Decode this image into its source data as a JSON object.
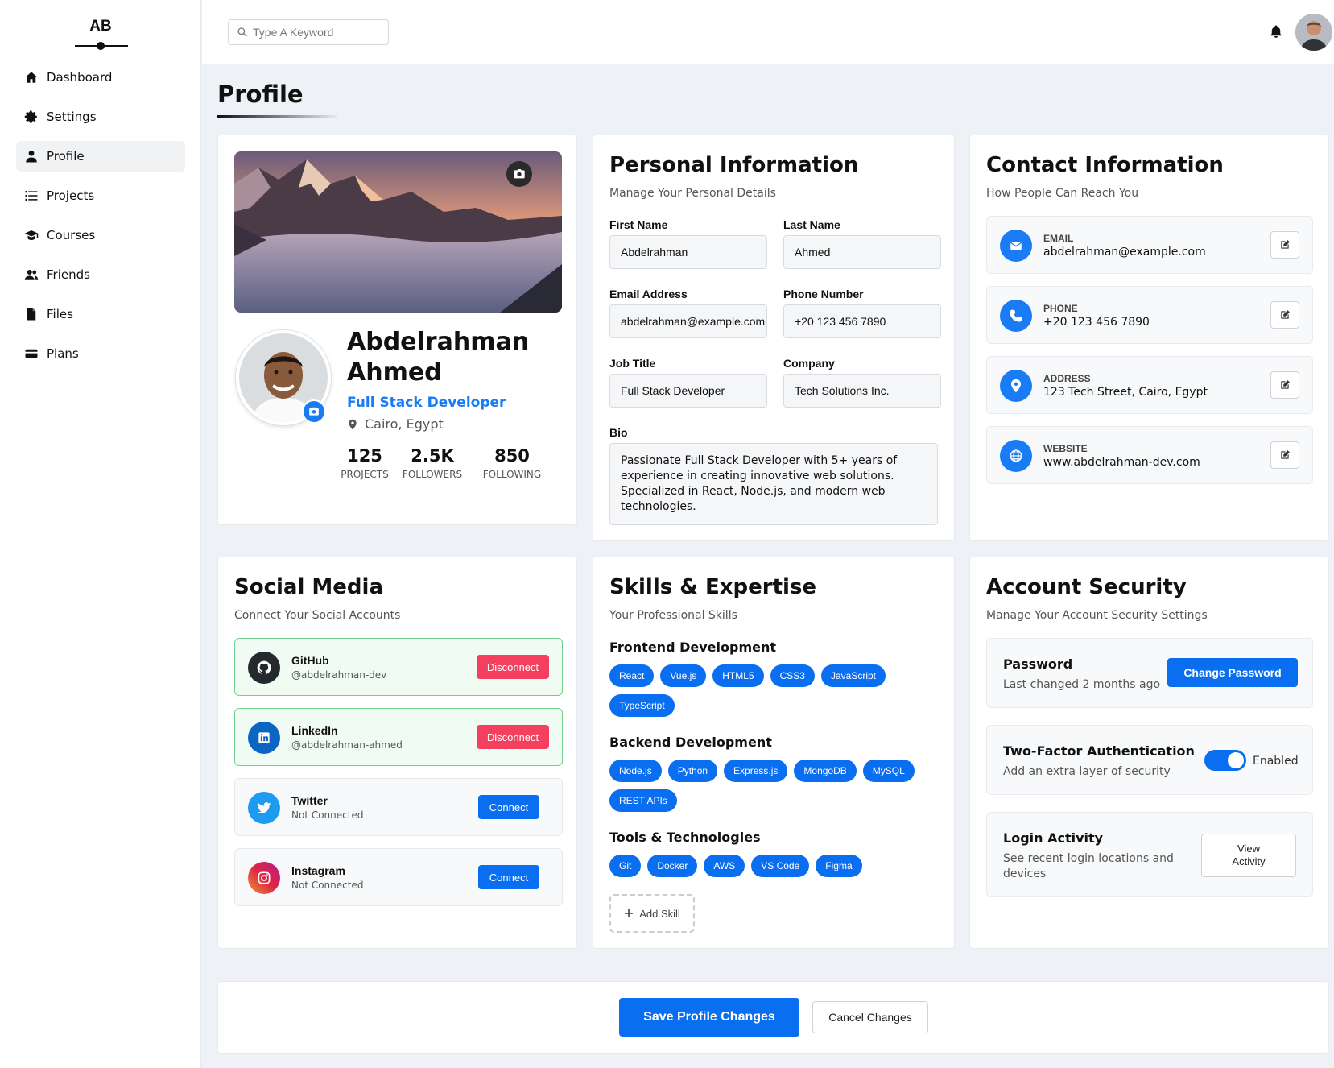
{
  "brand": {
    "logo_text": "AB"
  },
  "sidebar": {
    "items": [
      {
        "label": "Dashboard",
        "icon": "home-icon"
      },
      {
        "label": "Settings",
        "icon": "gear-icon"
      },
      {
        "label": "Profile",
        "icon": "user-icon",
        "active": true
      },
      {
        "label": "Projects",
        "icon": "list-icon"
      },
      {
        "label": "Courses",
        "icon": "graduation-cap-icon"
      },
      {
        "label": "Friends",
        "icon": "users-icon"
      },
      {
        "label": "Files",
        "icon": "file-icon"
      },
      {
        "label": "Plans",
        "icon": "credit-card-icon"
      }
    ]
  },
  "header": {
    "search_placeholder": "Type A Keyword"
  },
  "page": {
    "title": "Profile"
  },
  "profile": {
    "first_name_line": "Abdelrahman",
    "last_name_line": "Ahmed",
    "role": "Full Stack Developer",
    "location": "Cairo, Egypt",
    "stats": [
      {
        "value": "125",
        "label": "PROJECTS"
      },
      {
        "value": "2.5K",
        "label": "FOLLOWERS"
      },
      {
        "value": "850",
        "label": "FOLLOWING"
      }
    ]
  },
  "personal": {
    "title": "Personal Information",
    "subtitle": "Manage Your Personal Details",
    "first_name_label": "First Name",
    "first_name": "Abdelrahman",
    "last_name_label": "Last Name",
    "last_name": "Ahmed",
    "email_label": "Email Address",
    "email": "abdelrahman@example.com",
    "phone_label": "Phone Number",
    "phone": "+20 123 456 7890",
    "job_label": "Job Title",
    "job": "Full Stack Developer",
    "company_label": "Company",
    "company": "Tech Solutions Inc.",
    "bio_label": "Bio",
    "bio": "Passionate Full Stack Developer with 5+ years of experience in creating innovative web solutions. Specialized in React, Node.js, and modern web technologies."
  },
  "contact": {
    "title": "Contact Information",
    "subtitle": "How People Can Reach You",
    "items": [
      {
        "type": "EMAIL",
        "value": "abdelrahman@example.com",
        "icon": "envelope-icon"
      },
      {
        "type": "PHONE",
        "value": "+20 123 456 7890",
        "icon": "phone-icon"
      },
      {
        "type": "ADDRESS",
        "value": "123 Tech Street, Cairo, Egypt",
        "icon": "map-pin-icon"
      },
      {
        "type": "WEBSITE",
        "value": "www.abdelrahman-dev.com",
        "icon": "globe-icon"
      }
    ]
  },
  "social": {
    "title": "Social Media",
    "subtitle": "Connect Your Social Accounts",
    "items": [
      {
        "name": "GitHub",
        "handle": "@abdelrahman-dev",
        "action": "Disconnect",
        "color": "#24292e"
      },
      {
        "name": "LinkedIn",
        "handle": "@abdelrahman-ahmed",
        "action": "Disconnect",
        "color": "#0a66c2"
      },
      {
        "name": "Twitter",
        "handle": "Not Connected",
        "action": "Connect",
        "color": "#1d9bf0"
      },
      {
        "name": "Instagram",
        "handle": "Not Connected",
        "action": "Connect",
        "color": "#e1306c"
      }
    ]
  },
  "skills": {
    "title": "Skills & Expertise",
    "subtitle": "Your Professional Skills",
    "groups": [
      {
        "name": "Frontend Development",
        "tags": [
          "React",
          "Vue.js",
          "HTML5",
          "CSS3",
          "JavaScript",
          "TypeScript"
        ]
      },
      {
        "name": "Backend Development",
        "tags": [
          "Node.js",
          "Python",
          "Express.js",
          "MongoDB",
          "MySQL",
          "REST APIs"
        ]
      },
      {
        "name": "Tools & Technologies",
        "tags": [
          "Git",
          "Docker",
          "AWS",
          "VS Code",
          "Figma"
        ]
      }
    ],
    "add_label": "Add Skill"
  },
  "security": {
    "title": "Account Security",
    "subtitle": "Manage Your Account Security Settings",
    "password_title": "Password",
    "password_sub": "Last changed 2 months ago",
    "password_btn": "Change Password",
    "tfa_title": "Two-Factor Authentication",
    "tfa_sub": "Add an extra layer of security",
    "tfa_state": "Enabled",
    "login_title": "Login Activity",
    "login_sub": "See recent login locations and devices",
    "login_btn": "View Activity"
  },
  "footer": {
    "save": "Save Profile Changes",
    "cancel": "Cancel Changes"
  },
  "colors": {
    "accent": "#0a6ef0",
    "danger": "#f43f5e",
    "connected_border": "#6fd08f"
  }
}
